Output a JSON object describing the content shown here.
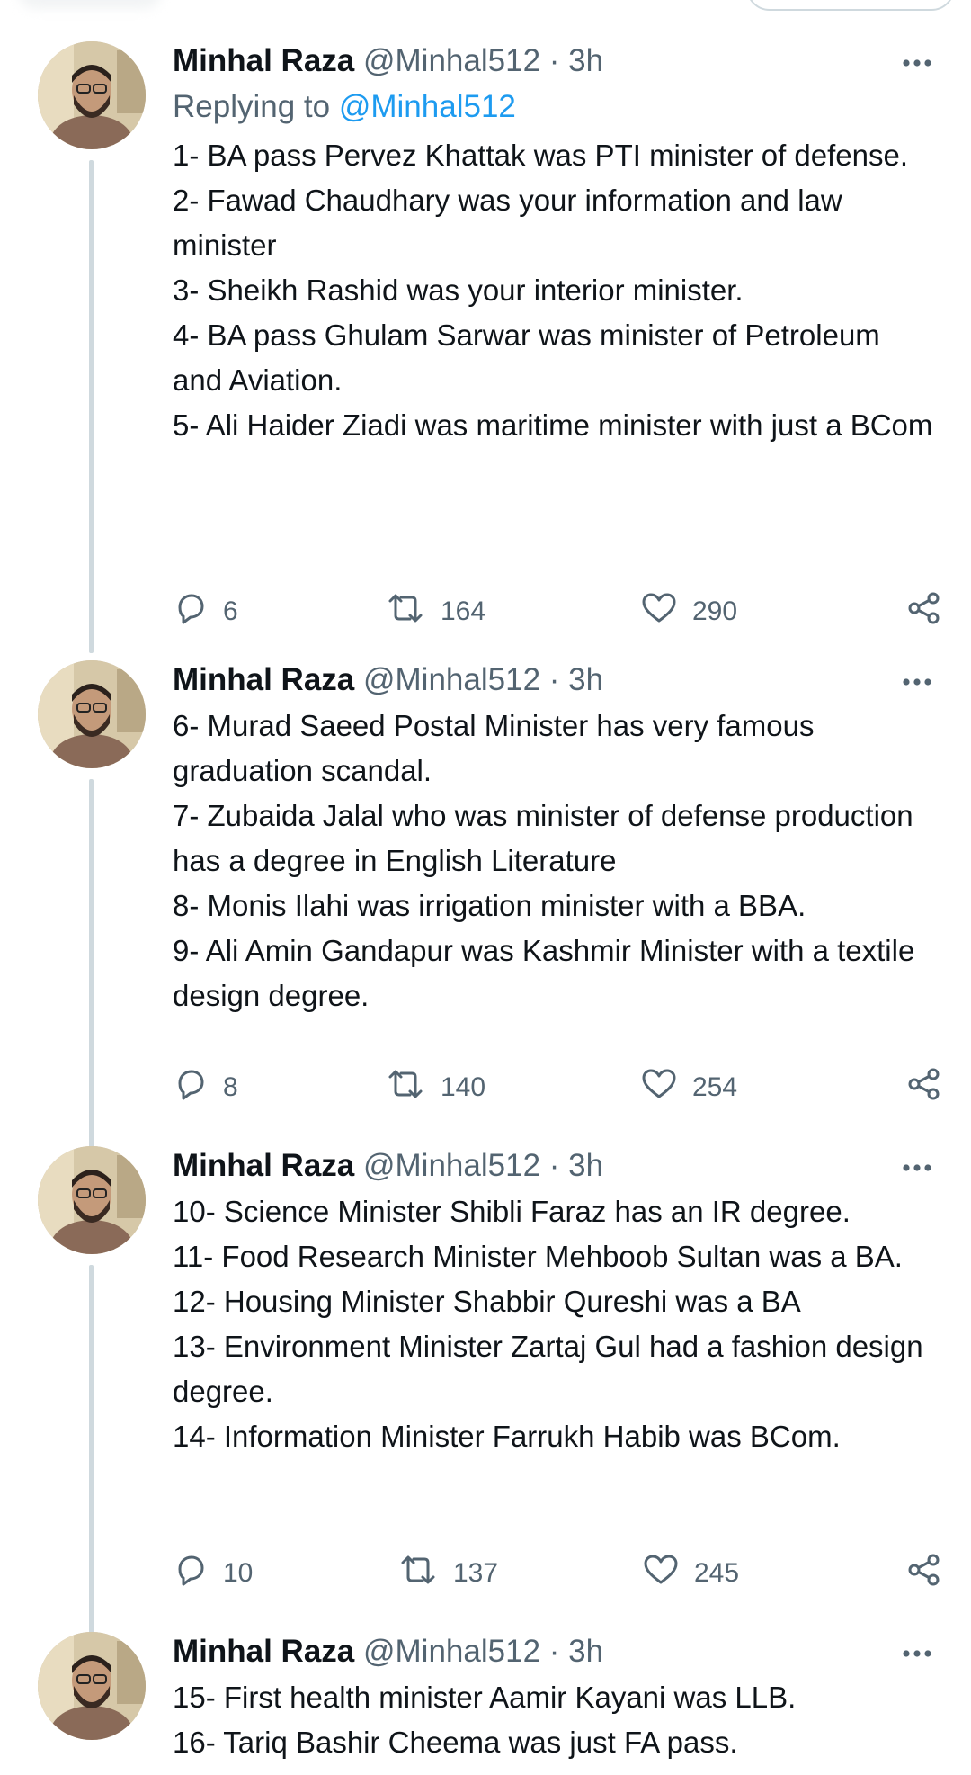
{
  "tweets": [
    {
      "name": "Minhal Raza",
      "handle": "@Minhal512",
      "separator": "·",
      "time": "3h",
      "replying_prefix": "Replying to",
      "replying_to": "@Minhal512",
      "lines": [
        "1- BA pass Pervez Khattak was PTI minister of defense.",
        "2- Fawad Chaudhary was your information and law minister",
        "3- Sheikh Rashid was your interior minister.",
        "4- BA pass Ghulam Sarwar was minister of Petroleum and Aviation.",
        "5- Ali Haider Ziadi was maritime minister with just a BCom"
      ],
      "replies": "6",
      "retweets": "164",
      "likes": "290"
    },
    {
      "name": "Minhal Raza",
      "handle": "@Minhal512",
      "separator": "·",
      "time": "3h",
      "lines": [
        "6- Murad Saeed Postal Minister has very famous graduation scandal.",
        "7- Zubaida Jalal who was minister of defense production has a degree in English Literature",
        "8- Monis Ilahi was irrigation minister with a BBA.",
        "9- Ali Amin Gandapur was Kashmir Minister with a textile design degree."
      ],
      "replies": "8",
      "retweets": "140",
      "likes": "254"
    },
    {
      "name": "Minhal Raza",
      "handle": "@Minhal512",
      "separator": "·",
      "time": "3h",
      "lines": [
        "10- Science Minister Shibli Faraz has an IR degree.",
        "11- Food Research Minister Mehboob Sultan was a BA.",
        "12- Housing Minister Shabbir Qureshi was a BA",
        "13- Environment Minister Zartaj Gul had a fashion design degree.",
        "14- Information Minister Farrukh Habib was BCom."
      ],
      "replies": "10",
      "retweets": "137",
      "likes": "245"
    },
    {
      "name": "Minhal Raza",
      "handle": "@Minhal512",
      "separator": "·",
      "time": "3h",
      "lines": [
        "15- First health minister Aamir Kayani was LLB.",
        "16- Tariq Bashir Cheema was just FA pass."
      ]
    }
  ],
  "icons": {
    "reply": "reply-icon",
    "retweet": "retweet-icon",
    "like": "heart-icon",
    "share": "share-icon",
    "more": "more-options-icon"
  },
  "colors": {
    "text": "#0f1419",
    "secondary": "#536471",
    "link": "#1d9bf0",
    "connector": "#cfd9de"
  }
}
